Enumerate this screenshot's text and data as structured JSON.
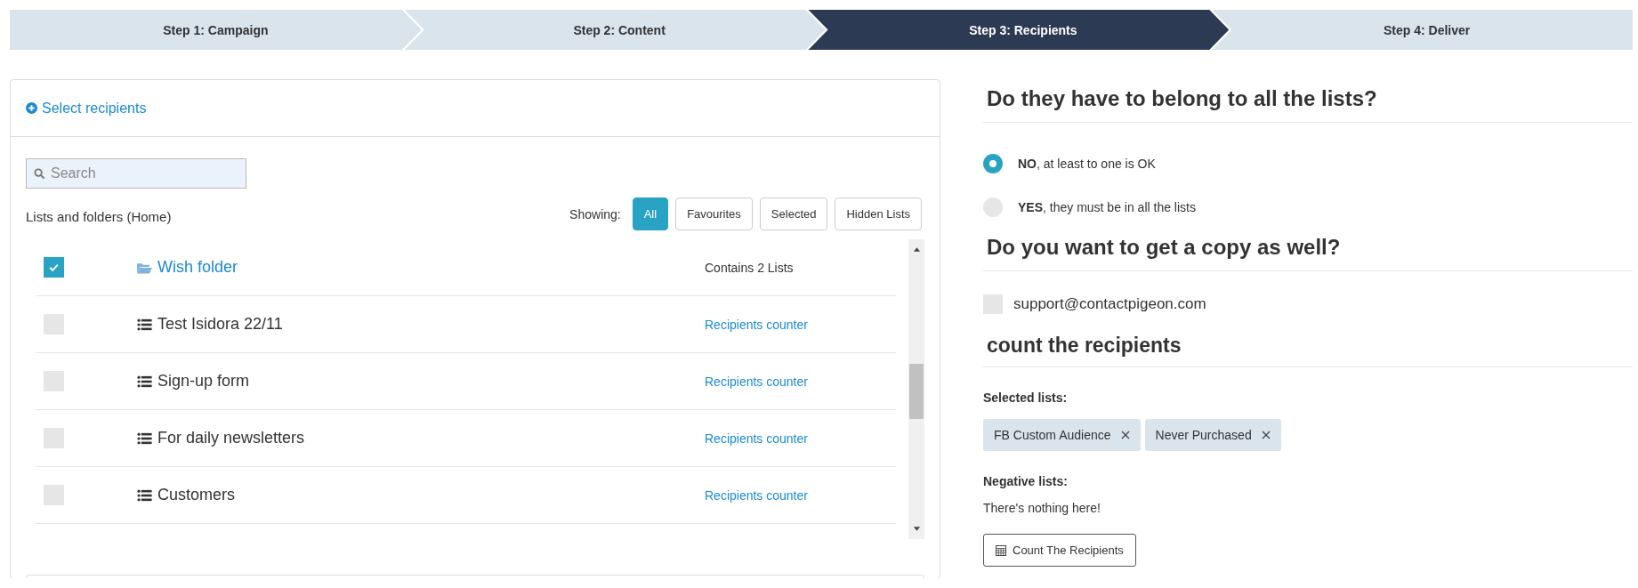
{
  "steps": [
    {
      "label": "Step 1: Campaign",
      "selected": false
    },
    {
      "label": "Step 2: Content",
      "selected": false
    },
    {
      "label": "Step 3: Recipients",
      "selected": true
    },
    {
      "label": "Step 4: Deliver",
      "selected": false
    }
  ],
  "recipients_panel": {
    "title": "Select recipients",
    "search": {
      "placeholder": "Search"
    },
    "lists_label": "Lists and folders (Home)",
    "showing_label": "Showing:",
    "filters": [
      {
        "label": "All",
        "selected": true
      },
      {
        "label": "Favourites",
        "selected": false
      },
      {
        "label": "Selected",
        "selected": false
      },
      {
        "label": "Hidden Lists",
        "selected": false
      }
    ],
    "rows": [
      {
        "kind": "folder",
        "name": "Wish folder",
        "checked": true,
        "info": "Contains 2 Lists"
      },
      {
        "kind": "list",
        "name": "Test Isidora 22/11",
        "checked": false,
        "info": "Recipients counter"
      },
      {
        "kind": "list",
        "name": "Sign-up form",
        "checked": false,
        "info": "Recipients counter"
      },
      {
        "kind": "list",
        "name": "For daily newsletters",
        "checked": false,
        "info": "Recipients counter"
      },
      {
        "kind": "list",
        "name": "Customers",
        "checked": false,
        "info": "Recipients counter"
      }
    ]
  },
  "belong_section": {
    "heading": "Do they have to belong to all the lists?",
    "options": [
      {
        "label": "**NO**, at least to one is OK",
        "selected": true
      },
      {
        "label": "**YES**, they must be in all the lists",
        "selected": false
      }
    ]
  },
  "copy_section": {
    "heading": "Do you want to get a copy as well?",
    "email": "support@contactpigeon.com",
    "checked": false
  },
  "count_section": {
    "heading": "count the recipients",
    "selected_label": "Selected lists:",
    "selected_lists": [
      "FB Custom Audience",
      "Never Purchased"
    ],
    "negative_label": "Negative lists:",
    "negative_empty": "There's nothing here!",
    "button": "Count The Recipients"
  }
}
